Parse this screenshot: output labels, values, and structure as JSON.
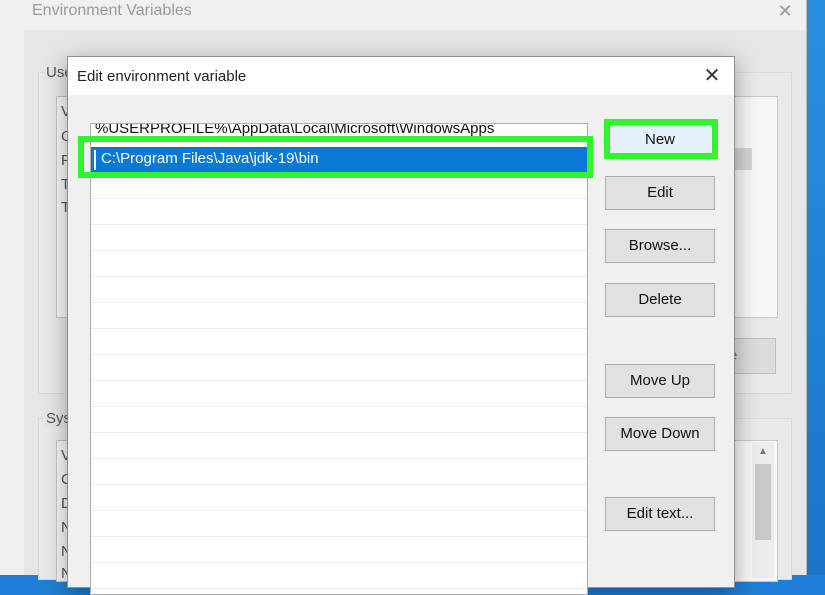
{
  "parent_window": {
    "title": "Environment Variables",
    "close_glyph": "✕",
    "user_group_label": "Use",
    "system_group_label": "Sys",
    "user_letters": [
      "V",
      "O",
      "P",
      "T",
      "T"
    ],
    "system_letters": [
      "V",
      "C",
      "D",
      "N",
      "N",
      "N"
    ],
    "partial_button_text": "e",
    "scroll_up_glyph": "▲"
  },
  "dialog": {
    "title": "Edit environment variable",
    "close_glyph": "✕",
    "entries": [
      "%USERPROFILE%\\AppData\\Local\\Microsoft\\WindowsApps",
      "C:\\Program Files\\Java\\jdk-19\\bin"
    ],
    "selected_index": 1,
    "buttons": {
      "new": "New",
      "edit": "Edit",
      "browse": "Browse...",
      "delete": "Delete",
      "move_up": "Move Up",
      "move_down": "Move Down",
      "edit_text": "Edit text..."
    }
  },
  "colors": {
    "highlight": "#31f52e",
    "selection": "#0a78d7"
  }
}
